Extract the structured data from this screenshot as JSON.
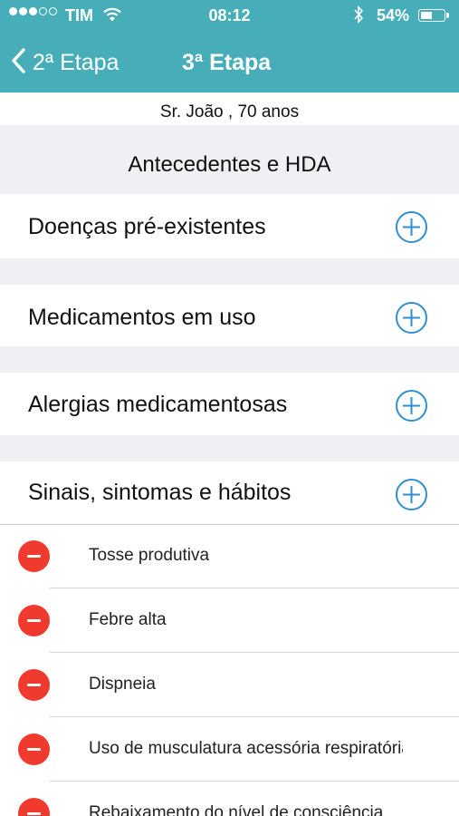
{
  "status_bar": {
    "carrier": "TIM",
    "time": "08:12",
    "battery": "54%",
    "battery_level": 0.54,
    "signal_bars_filled": 3,
    "signal_bars_total": 5
  },
  "nav": {
    "back_label": "2ª Etapa",
    "title": "3ª Etapa"
  },
  "patient": "Sr. João , 70 anos",
  "section_title": "Antecedentes e HDA",
  "categories": [
    {
      "label": "Doenças pré-existentes"
    },
    {
      "label": "Medicamentos em uso"
    },
    {
      "label": "Alergias medicamentosas"
    },
    {
      "label": "Sinais, sintomas e hábitos"
    }
  ],
  "symptoms": [
    {
      "label": "Tosse produtiva"
    },
    {
      "label": "Febre alta"
    },
    {
      "label": "Dispneia"
    },
    {
      "label": "Uso de musculatura acessória respiratória"
    },
    {
      "label": "Rebaixamento do nível de consciência"
    }
  ],
  "colors": {
    "header": "#47aeb9",
    "accent_blue": "#2f8fd0",
    "delete_red": "#f03a2e",
    "background": "#efeff4"
  },
  "icons": {
    "add": "plus-circle-icon",
    "remove": "minus-circle-icon",
    "back": "chevron-left-icon"
  }
}
